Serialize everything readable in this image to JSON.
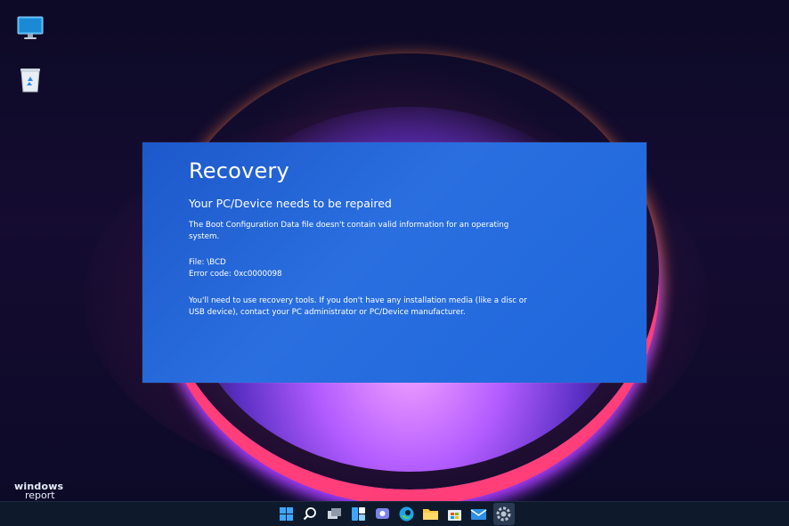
{
  "desktop": {
    "icons": [
      "this-pc-icon",
      "recycle-bin-icon"
    ]
  },
  "recovery": {
    "title": "Recovery",
    "subtitle": "Your PC/Device needs to be repaired",
    "p1_line1": "The Boot Configuration Data file doesn't contain valid information for an operating",
    "p1_line2": "system.",
    "file_line": "File: \\BCD",
    "error_line": "Error code: 0xc0000098",
    "p3_line1": "You'll need to use recovery tools. If you don't have any installation media (like a disc or",
    "p3_line2": "USB device), contact your PC administrator or PC/Device manufacturer.",
    "bg_color": "#1f62d6"
  },
  "watermark": {
    "line1": "windows",
    "line2": "report"
  },
  "taskbar": {
    "icons": [
      "start-icon",
      "search-icon",
      "task-view-icon",
      "widgets-icon",
      "teams-chat-icon",
      "edge-icon",
      "file-explorer-icon",
      "store-icon",
      "mail-icon",
      "settings-icon"
    ],
    "active": "settings-icon"
  }
}
